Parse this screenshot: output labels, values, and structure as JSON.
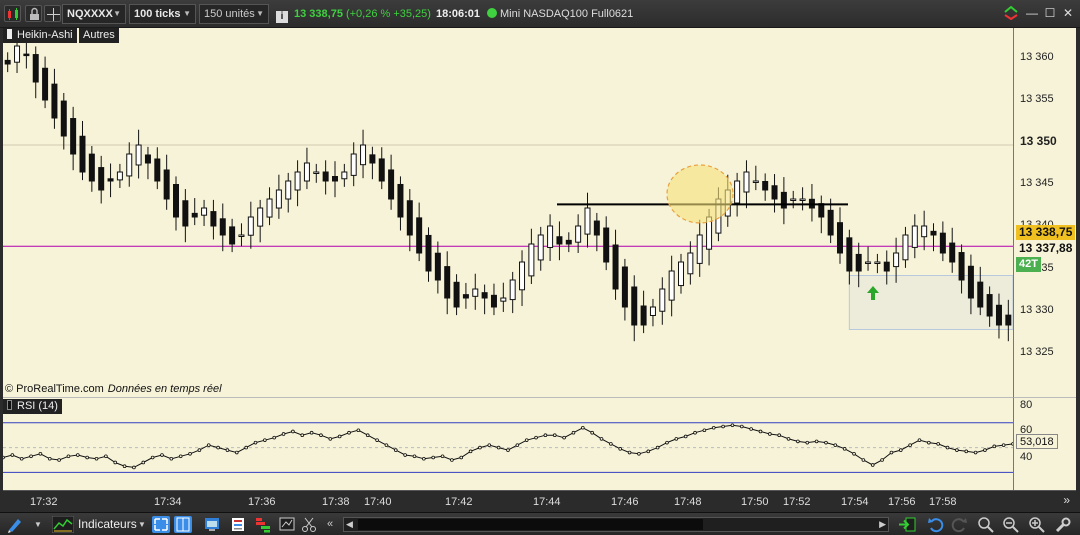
{
  "toolbar": {
    "symbol": "NQXXXX",
    "ticks": "100 ticks",
    "units": "150 unités",
    "price": "13 338,75",
    "change": "(+0,26 % +35,25)",
    "time": "18:06:01",
    "instrument": "Mini NASDAQ100 Full0621",
    "colors": {
      "up": "#3fd13f",
      "bg": "#2c2c2c"
    }
  },
  "price_pane": {
    "style_tag": "Heikin-Ashi",
    "others_tag": "Autres",
    "copyright": "© ProRealTime.com",
    "realtime": "Données en temps réel",
    "axis_labels": [
      "13 360",
      "13 355",
      "13 350",
      "13 345",
      "13 340",
      "13 335",
      "13 330",
      "13 325"
    ],
    "current_price": "13 338,75",
    "last_close": "13 337,88",
    "countdown": "42T",
    "colors": {
      "background": "#f7f3d8",
      "candle": "#111111",
      "hline": "#b000b0",
      "flag": "#f0c020"
    }
  },
  "rsi_pane": {
    "label": "RSI (14)",
    "axis_labels": [
      "80",
      "60",
      "40"
    ],
    "value": "53,018"
  },
  "time_axis": {
    "labels": [
      "17:32",
      "17:34",
      "17:36",
      "17:38",
      "17:40",
      "17:42",
      "17:44",
      "17:46",
      "17:48",
      "17:50",
      "17:52",
      "17:54",
      "17:56",
      "17:58"
    ]
  },
  "bottombar": {
    "indicators_label": "Indicateurs"
  },
  "chart_data": {
    "type": "candlestick",
    "style": "Heikin-Ashi",
    "ylim": [
      13322,
      13363
    ],
    "series_close": [
      13359,
      13361,
      13360,
      13357,
      13355,
      13353,
      13351,
      13349,
      13347,
      13346,
      13345,
      13346,
      13347,
      13349,
      13350,
      13348,
      13346,
      13344,
      13342,
      13341,
      13342,
      13343,
      13341,
      13340,
      13339,
      13340,
      13342,
      13343,
      13344,
      13345,
      13346,
      13347,
      13348,
      13347,
      13346,
      13346,
      13347,
      13349,
      13350,
      13348,
      13346,
      13344,
      13342,
      13340,
      13338,
      13336,
      13335,
      13333,
      13332,
      13333,
      13334,
      13333,
      13332,
      13333,
      13335,
      13337,
      13339,
      13340,
      13341,
      13339,
      13339,
      13341,
      13343,
      13340,
      13337,
      13334,
      13332,
      13330,
      13330,
      13332,
      13334,
      13336,
      13337,
      13338,
      13340,
      13342,
      13344,
      13345,
      13346,
      13347,
      13346,
      13345,
      13344,
      13343,
      13344,
      13344,
      13343,
      13342,
      13340,
      13338,
      13336,
      13336,
      13337,
      13337,
      13336,
      13338,
      13340,
      13341,
      13341,
      13340,
      13338,
      13337,
      13335,
      13333,
      13332,
      13331,
      13330,
      13330
    ],
    "horizontal_level": 13343.4,
    "magenta_level": 13338.75,
    "zone": {
      "from": 13329.5,
      "to": 13335.5
    },
    "rsi_ylim": [
      15,
      90
    ],
    "rsi_values": [
      42,
      44,
      41,
      43,
      45,
      41,
      40,
      43,
      44,
      42,
      41,
      43,
      38,
      35,
      34,
      38,
      42,
      44,
      41,
      43,
      45,
      48,
      52,
      50,
      48,
      46,
      50,
      54,
      56,
      58,
      61,
      63,
      60,
      62,
      60,
      57,
      59,
      62,
      64,
      60,
      56,
      52,
      48,
      44,
      43,
      41,
      42,
      43,
      40,
      42,
      47,
      50,
      52,
      50,
      48,
      52,
      56,
      58,
      60,
      60,
      58,
      62,
      66,
      62,
      57,
      53,
      49,
      46,
      45,
      47,
      50,
      54,
      57,
      59,
      62,
      64,
      66,
      67,
      68,
      67,
      65,
      63,
      61,
      60,
      57,
      55,
      54,
      55,
      54,
      52,
      49,
      45,
      40,
      36,
      40,
      46,
      48,
      52,
      56,
      54,
      53,
      50,
      48,
      47,
      46,
      48,
      51,
      52,
      53
    ],
    "rsi_levels": [
      70,
      30
    ]
  }
}
